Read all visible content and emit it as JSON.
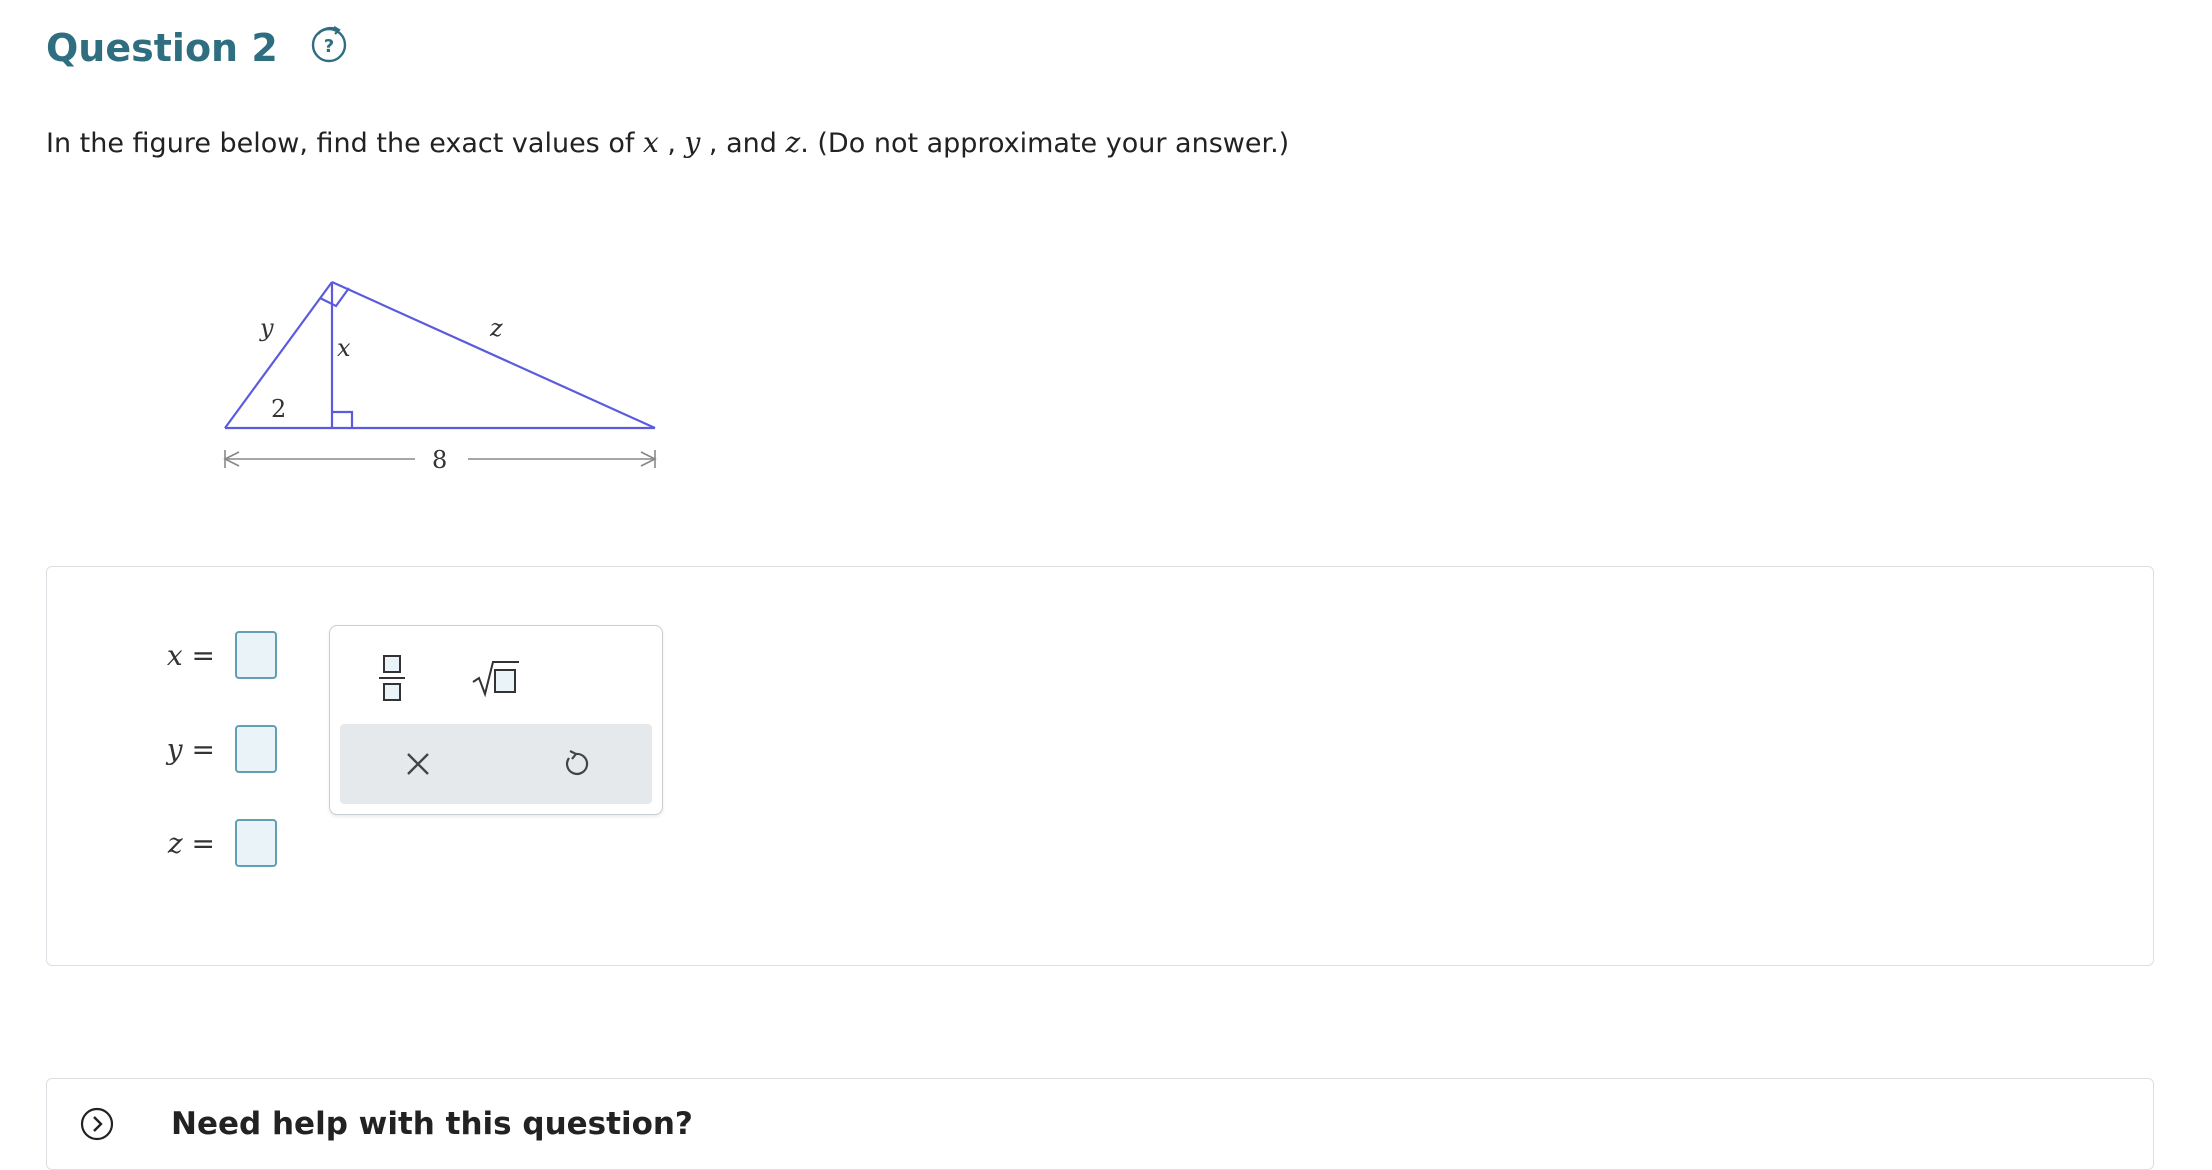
{
  "question": {
    "title": "Question 2",
    "help_icon": "question-cycle-icon"
  },
  "prompt": {
    "before": "In the figure below, find the exact values of ",
    "var_x": "x",
    "sep1": " , ",
    "var_y": "y",
    "sep2": " , and ",
    "var_z": "z",
    "after": ". (Do not approximate your answer.)"
  },
  "figure": {
    "label_y": "y",
    "label_x": "x",
    "label_z": "z",
    "label_segment": "2",
    "label_base": "8",
    "line_color": "#5b5bde",
    "dim_color": "#888888"
  },
  "answers": [
    {
      "var": "x",
      "eq": "=",
      "value": ""
    },
    {
      "var": "y",
      "eq": "=",
      "value": ""
    },
    {
      "var": "z",
      "eq": "=",
      "value": ""
    }
  ],
  "palette": {
    "fraction_icon": "fraction-template-icon",
    "sqrt_icon": "square-root-template-icon",
    "clear_icon": "close-icon",
    "undo_icon": "undo-icon"
  },
  "help": {
    "label": "Need help with this question?",
    "icon": "chevron-right-circle-icon"
  },
  "colors": {
    "title": "#2e6e80",
    "accent": "#5fa0b4",
    "answer_fill": "#eaf4f8"
  }
}
